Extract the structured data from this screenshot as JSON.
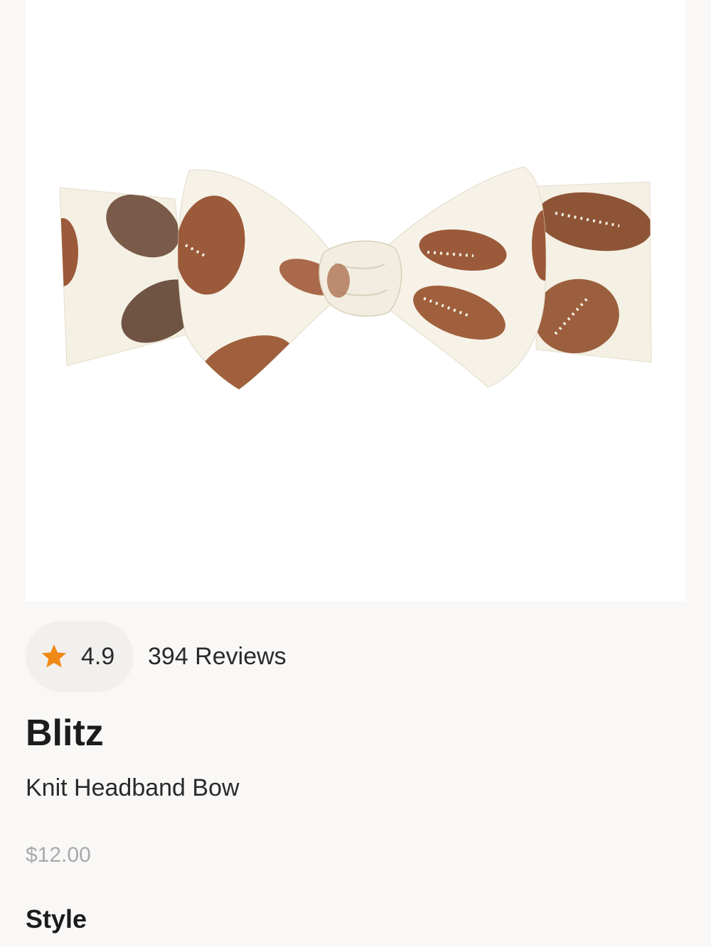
{
  "product": {
    "image_alt": "Blitz Knit Headband Bow",
    "rating": "4.9",
    "reviews_label": "394 Reviews",
    "title": "Blitz",
    "subtitle": "Knit Headband Bow",
    "price": "$12.00"
  },
  "options": {
    "style_heading": "Style"
  },
  "icons": {
    "rating": "star-icon"
  },
  "colors": {
    "star": "#f08a16",
    "price": "#a9a9a9",
    "background": "#f9f8f6",
    "fabric": "#f4f0e4",
    "football": "#9b5a3a"
  }
}
